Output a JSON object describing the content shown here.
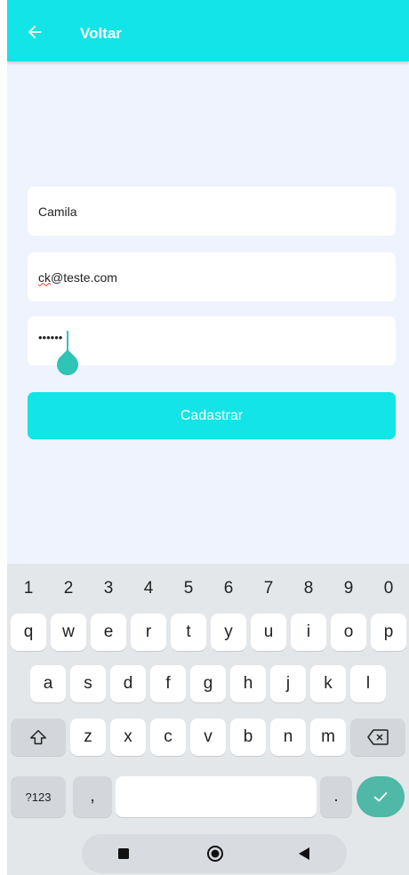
{
  "app_bar": {
    "title": "Voltar",
    "back_icon": "arrow-back-icon",
    "color": "#12e4e7"
  },
  "form": {
    "name_value": "Camila",
    "email_user": "ck",
    "email_domain": "@teste.com",
    "password_value": "••••••",
    "submit_label": "Cadastrar"
  },
  "keyboard": {
    "numbers": [
      "1",
      "2",
      "3",
      "4",
      "5",
      "6",
      "7",
      "8",
      "9",
      "0"
    ],
    "row1": [
      "q",
      "w",
      "e",
      "r",
      "t",
      "y",
      "u",
      "i",
      "o",
      "p"
    ],
    "row2": [
      "a",
      "s",
      "d",
      "f",
      "g",
      "h",
      "j",
      "k",
      "l"
    ],
    "row3": [
      "z",
      "x",
      "c",
      "v",
      "b",
      "n",
      "m"
    ],
    "symbols_label": "?123",
    "comma_label": ",",
    "period_label": ".",
    "shift_icon": "shift-icon",
    "backspace_icon": "backspace-icon",
    "enter_icon": "checkmark-icon",
    "enter_color": "#4fb8a6"
  },
  "nav_bar": {
    "recents_icon": "square-icon",
    "home_icon": "circle-icon",
    "back_icon": "triangle-back-icon"
  }
}
